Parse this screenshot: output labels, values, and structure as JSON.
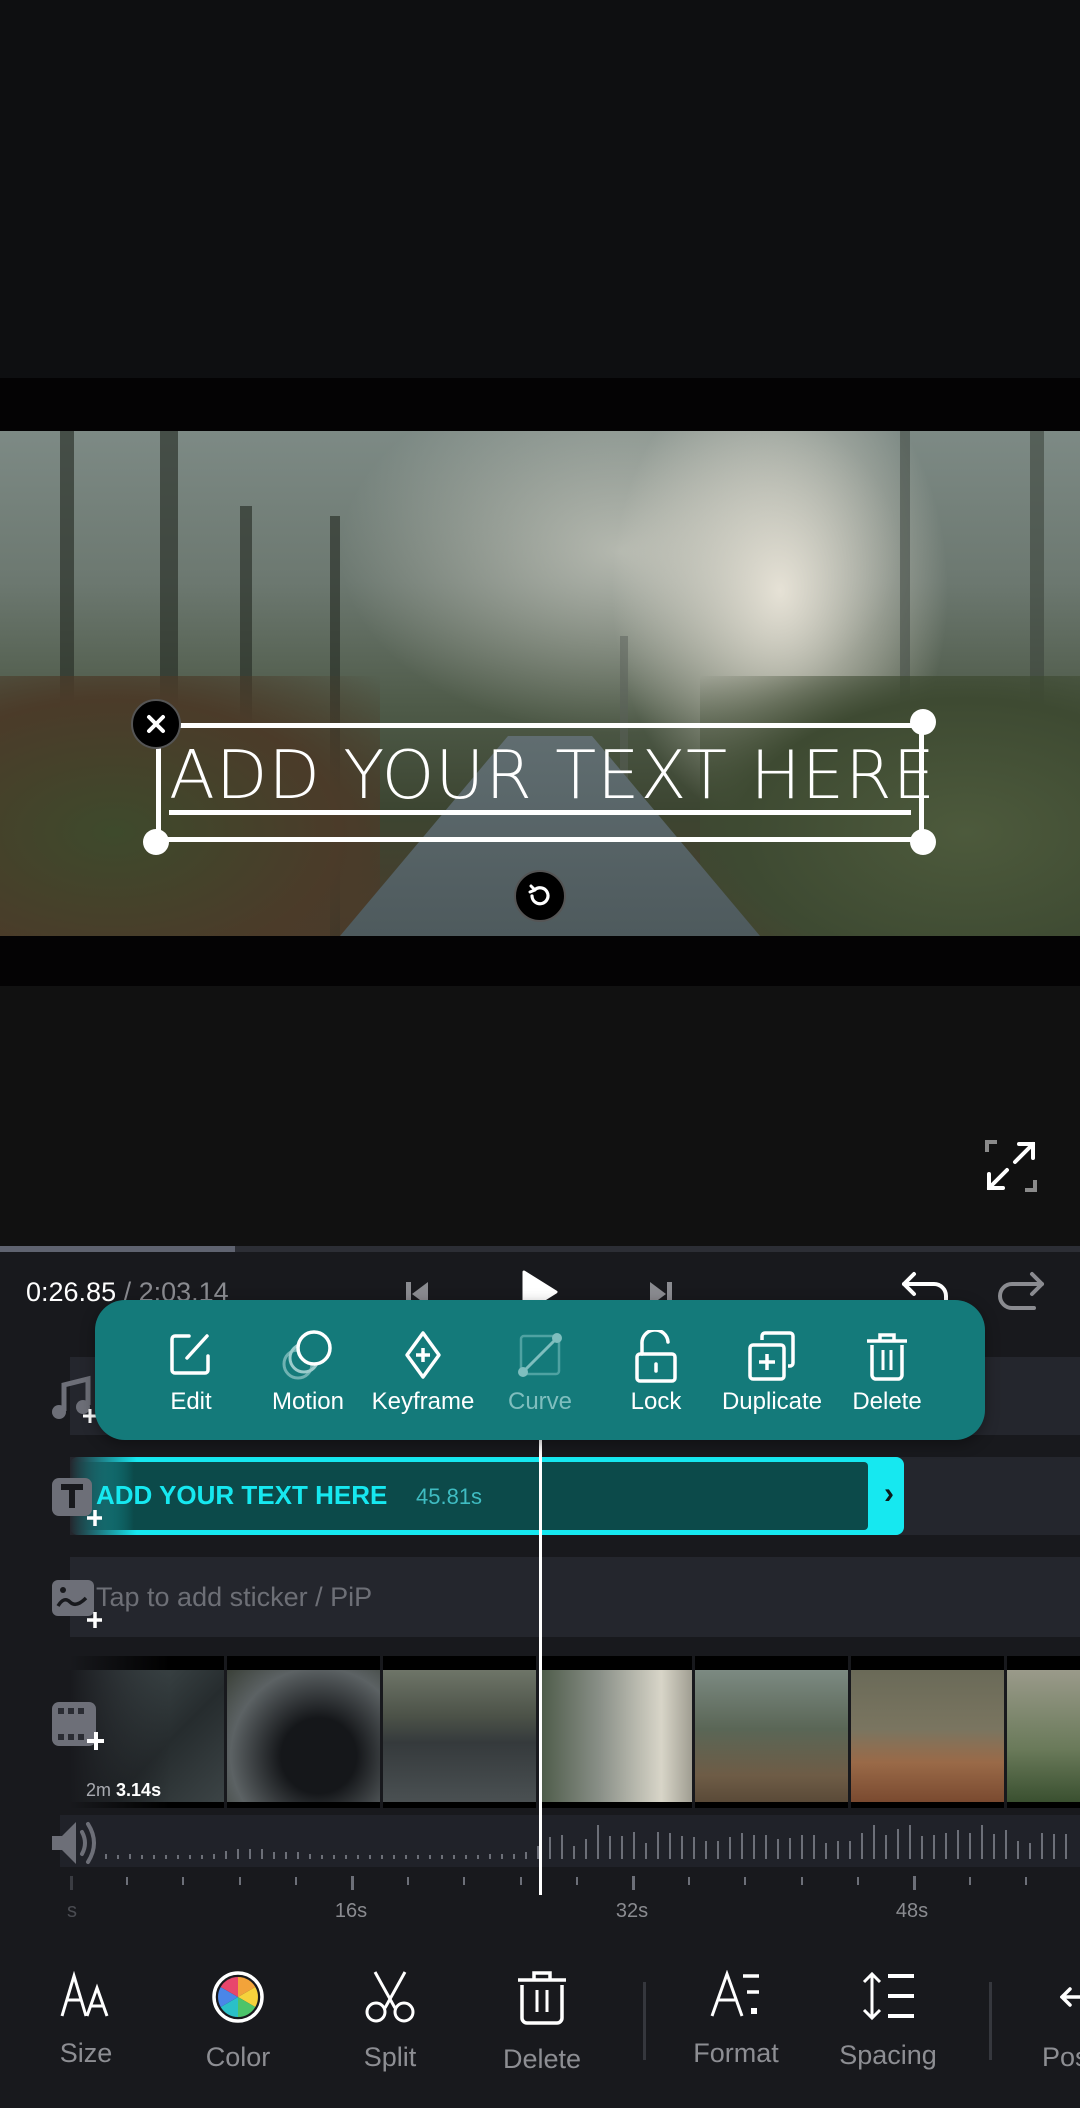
{
  "preview": {
    "text_overlay": "ADD YOUR TEXT HERE",
    "close_icon": "close-icon",
    "rotate_icon": "rotate-icon",
    "fullscreen_icon": "fullscreen-icon"
  },
  "playback": {
    "current_time": "0:26.85",
    "total_time": " / 2:03.14",
    "progress": 0.218,
    "prev_icon": "skip-previous-icon",
    "play_icon": "play-icon",
    "next_icon": "skip-next-icon",
    "undo_icon": "undo-icon",
    "redo_icon": "redo-icon"
  },
  "popup_menu": {
    "items": [
      {
        "label": "Edit",
        "icon": "edit-icon",
        "enabled": true
      },
      {
        "label": "Motion",
        "icon": "motion-icon",
        "enabled": true
      },
      {
        "label": "Keyframe",
        "icon": "keyframe-icon",
        "enabled": true
      },
      {
        "label": "Curve",
        "icon": "curve-icon",
        "enabled": false
      },
      {
        "label": "Lock",
        "icon": "unlock-icon",
        "enabled": true
      },
      {
        "label": "Duplicate",
        "icon": "duplicate-icon",
        "enabled": true
      },
      {
        "label": "Delete",
        "icon": "trash-icon",
        "enabled": true
      }
    ]
  },
  "timeline": {
    "text_clip": {
      "label": "ADD YOUR TEXT HERE",
      "duration": "45.81s"
    },
    "sticker_hint": "Tap to add sticker / PiP",
    "video_duration_prefix": "2m",
    "video_duration_value": "3.14s",
    "ruler_labels": [
      "s",
      "16s",
      "32s",
      "48s"
    ],
    "audio_levels": [
      0.12,
      0.1,
      0.12,
      0.1,
      0.1,
      0.1,
      0.1,
      0.1,
      0.1,
      0.12,
      0.18,
      0.22,
      0.22,
      0.22,
      0.16,
      0.16,
      0.16,
      0.12,
      0.1,
      0.1,
      0.08,
      0.06,
      0.06,
      0.06,
      0.06,
      0.06,
      0.06,
      0.06,
      0.06,
      0.08,
      0.1,
      0.1,
      0.12,
      0.12,
      0.12,
      0.15,
      0.3,
      0.5,
      0.55,
      0.3,
      0.45,
      0.78,
      0.52,
      0.52,
      0.62,
      0.36,
      0.62,
      0.6,
      0.52,
      0.5,
      0.42,
      0.4,
      0.5,
      0.6,
      0.55,
      0.55,
      0.45,
      0.48,
      0.55,
      0.55,
      0.36,
      0.42,
      0.42,
      0.6,
      0.78,
      0.55,
      0.68,
      0.78,
      0.52,
      0.55,
      0.58,
      0.66,
      0.6,
      0.78,
      0.56,
      0.66,
      0.4,
      0.36,
      0.6,
      0.56,
      0.56
    ]
  },
  "bottom_toolbar": {
    "tools": [
      {
        "label": "Size",
        "icon": "text-size-icon"
      },
      {
        "label": "Color",
        "icon": "color-wheel-icon"
      },
      {
        "label": "Split",
        "icon": "scissors-icon"
      },
      {
        "label": "Delete",
        "icon": "trash-icon"
      },
      {
        "label": "Format",
        "icon": "text-format-icon"
      },
      {
        "label": "Spacing",
        "icon": "line-spacing-icon"
      },
      {
        "label": "Position",
        "icon": "position-icon"
      }
    ]
  }
}
